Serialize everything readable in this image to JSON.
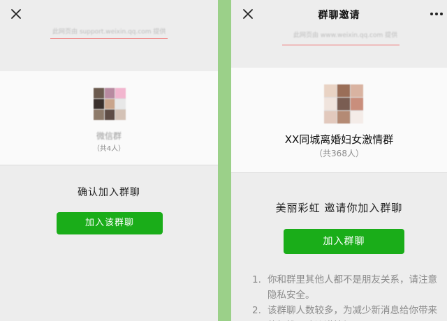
{
  "left_panel": {
    "close_icon": "close-icon",
    "source_note": "此网页由 support.weixin.qq.com 提供",
    "group_name": "微信群",
    "member_count": "（共4人）",
    "confirm_text": "确认加入群聊",
    "join_button_label": "加入该群聊",
    "underline_color": "#f06a6a",
    "button_color": "#1aad19"
  },
  "right_panel": {
    "close_icon": "close-icon",
    "title": "群聊邀请",
    "more_icon": "more-icon",
    "source_note": "此网页由 www.weixin.qq.com 提供",
    "group_name": "XX同城离婚妇女激情群",
    "member_count": "（共368人）",
    "invite_text": "美丽彩虹 邀请你加入群聊",
    "join_button_label": "加入群聊",
    "notices": [
      {
        "num": "1.",
        "text": "你和群里其他人都不是朋友关系，请注意隐私安全。"
      },
      {
        "num": "2.",
        "text": "该群聊人数较多，为减少新消息给你带来的打扰，建议谨慎加入。"
      }
    ],
    "button_color": "#1aad19"
  },
  "divider_color": "#9bd089"
}
